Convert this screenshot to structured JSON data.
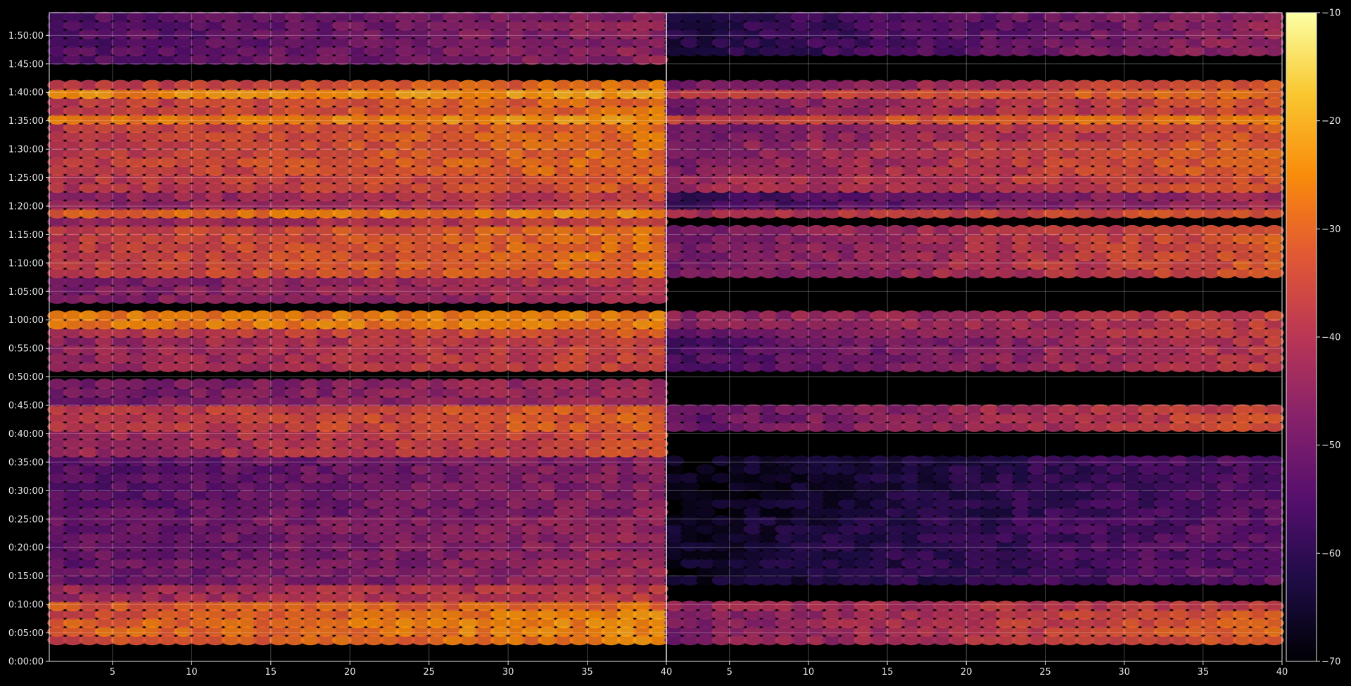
{
  "chart_data": {
    "type": "heatmap",
    "title": "",
    "xlabel": "",
    "ylabel": "",
    "grid": true,
    "colormap": "inferno",
    "colorbar": {
      "min": -70,
      "max": -10,
      "ticks": [
        -10,
        -20,
        -30,
        -40,
        -50,
        -60,
        -70
      ],
      "tick_labels": [
        "−10",
        "−20",
        "−30",
        "−40",
        "−50",
        "−60",
        "−70"
      ]
    },
    "y_axis": {
      "lim": [
        0,
        6840
      ],
      "ticks": [
        0,
        300,
        600,
        900,
        1200,
        1500,
        1800,
        2100,
        2400,
        2700,
        3000,
        3300,
        3600,
        3900,
        4200,
        4500,
        4800,
        5100,
        5400,
        5700,
        6000,
        6300,
        6600
      ],
      "tick_labels": [
        "0:00:00",
        "0:05:00",
        "0:10:00",
        "0:15:00",
        "0:20:00",
        "0:25:00",
        "0:30:00",
        "0:35:00",
        "0:40:00",
        "0:45:00",
        "0:50:00",
        "0:55:00",
        "1:00:00",
        "1:05:00",
        "1:10:00",
        "1:15:00",
        "1:20:00",
        "1:25:00",
        "1:30:00",
        "1:35:00",
        "1:40:00",
        "1:45:00",
        "1:50:00"
      ]
    },
    "panels": [
      {
        "x_lim": [
          1,
          40
        ],
        "x_ticks": [
          5,
          10,
          15,
          20,
          25,
          30,
          35,
          40
        ],
        "x_tick_labels": [
          "5",
          "10",
          "15",
          "20",
          "25",
          "30",
          "35",
          "40"
        ],
        "x_start": 1.5,
        "x_end": 39.5,
        "x_step": 1,
        "t_step": 90,
        "level_scale": 1.0,
        "bands": [
          {
            "t_from": 200,
            "t_to": 520,
            "level": -35,
            "slope": 10
          },
          {
            "t_from": 540,
            "t_to": 720,
            "level": -45,
            "slope": 6
          },
          {
            "t_from": 800,
            "t_to": 1500,
            "level": -52,
            "slope": 8
          },
          {
            "t_from": 1500,
            "t_to": 2200,
            "level": -54,
            "slope": 8
          },
          {
            "t_from": 2200,
            "t_to": 2450,
            "level": -44,
            "slope": 10
          },
          {
            "t_from": 2450,
            "t_to": 2700,
            "level": -40,
            "slope": 10
          },
          {
            "t_from": 2700,
            "t_to": 3000,
            "level": -50,
            "slope": 8
          },
          {
            "t_from": 3100,
            "t_to": 3450,
            "level": -45,
            "slope": 10
          },
          {
            "t_from": 3450,
            "t_to": 3700,
            "level": -40,
            "slope": 8
          },
          {
            "t_from": 3800,
            "t_to": 4000,
            "level": -48,
            "slope": 6
          },
          {
            "t_from": 4050,
            "t_to": 4550,
            "level": -38,
            "slope": 10
          },
          {
            "t_from": 4600,
            "t_to": 5000,
            "level": -46,
            "slope": 10
          },
          {
            "t_from": 5100,
            "t_to": 5500,
            "level": -38,
            "slope": 10
          },
          {
            "t_from": 5500,
            "t_to": 6100,
            "level": -38,
            "slope": 10
          },
          {
            "t_from": 6300,
            "t_to": 6840,
            "level": -55,
            "slope": 10
          }
        ],
        "hotlines": [
          {
            "t": 360,
            "level": -27,
            "slope": 6
          },
          {
            "t": 560,
            "level": -30,
            "slope": 3
          },
          {
            "t": 720,
            "level": -40,
            "slope": 6
          },
          {
            "t": 3600,
            "level": -24,
            "slope": 2
          },
          {
            "t": 4700,
            "level": -28,
            "slope": 6
          },
          {
            "t": 5040,
            "level": -36,
            "slope": 8
          },
          {
            "t": 5700,
            "level": -26,
            "slope": 4
          },
          {
            "t": 5980,
            "level": -25,
            "slope": 4
          },
          {
            "t": 3960,
            "level": -46,
            "slope": 10
          }
        ]
      },
      {
        "x_lim": [
          40,
          79
        ],
        "x_ticks": [
          44,
          49,
          54,
          59,
          64,
          69,
          74,
          79
        ],
        "x_tick_labels": [
          "5",
          "10",
          "15",
          "20",
          "25",
          "30",
          "35",
          "40"
        ],
        "x_start": 40.5,
        "x_end": 78.5,
        "x_step": 1,
        "t_step": 90,
        "level_scale": 1.0,
        "bands": [
          {
            "t_from": 200,
            "t_to": 520,
            "level": -48,
            "slope": 18
          },
          {
            "t_from": 800,
            "t_to": 1500,
            "level": -66,
            "slope": 14
          },
          {
            "t_from": 1500,
            "t_to": 2200,
            "level": -68,
            "slope": 14
          },
          {
            "t_from": 2450,
            "t_to": 2700,
            "level": -52,
            "slope": 18
          },
          {
            "t_from": 3100,
            "t_to": 3450,
            "level": -56,
            "slope": 18
          },
          {
            "t_from": 3450,
            "t_to": 3700,
            "level": -52,
            "slope": 16
          },
          {
            "t_from": 4050,
            "t_to": 4550,
            "level": -50,
            "slope": 18
          },
          {
            "t_from": 4700,
            "t_to": 5000,
            "level": -58,
            "slope": 16
          },
          {
            "t_from": 5100,
            "t_to": 5500,
            "level": -48,
            "slope": 18
          },
          {
            "t_from": 5500,
            "t_to": 6100,
            "level": -50,
            "slope": 18
          },
          {
            "t_from": 6400,
            "t_to": 6840,
            "level": -62,
            "slope": 18
          }
        ],
        "hotlines": [
          {
            "t": 560,
            "level": -42,
            "slope": 8
          },
          {
            "t": 3600,
            "level": -42,
            "slope": 6
          },
          {
            "t": 4700,
            "level": -40,
            "slope": 10
          },
          {
            "t": 5040,
            "level": -40,
            "slope": 10
          },
          {
            "t": 5700,
            "level": -36,
            "slope": 12
          },
          {
            "t": 5980,
            "level": -38,
            "slope": 10
          }
        ]
      }
    ]
  }
}
